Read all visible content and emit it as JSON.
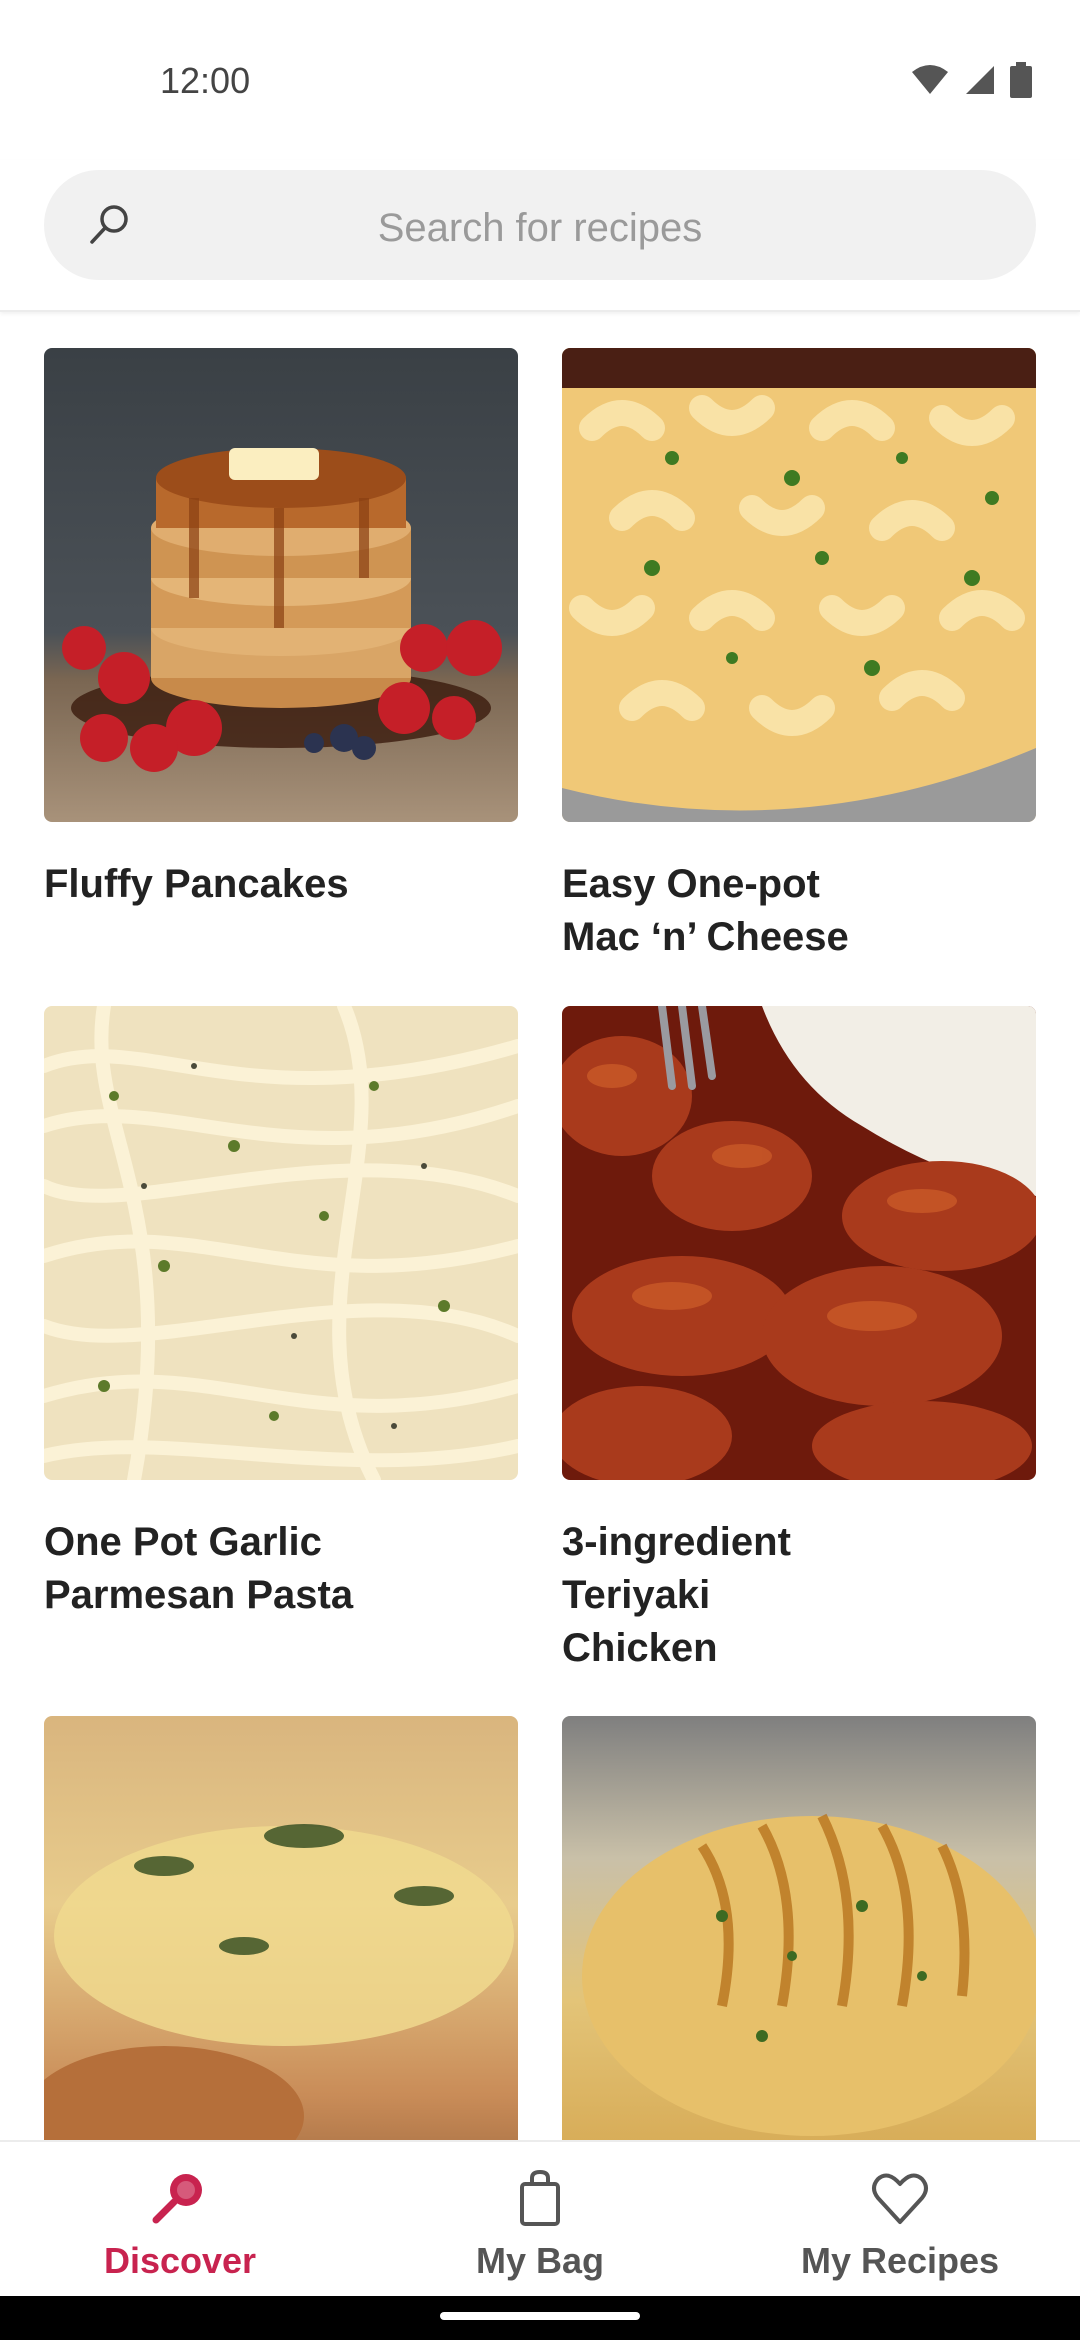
{
  "status_bar": {
    "time": "12:00"
  },
  "search": {
    "placeholder": "Search for recipes"
  },
  "recipes": [
    {
      "title": "Fluffy Pancakes",
      "image": "pancakes-photo"
    },
    {
      "title": "Easy One-pot Mac ‘n’ Cheese",
      "image": "mac-and-cheese-photo"
    },
    {
      "title": "One Pot Garlic Parmesan Pasta",
      "image": "garlic-parmesan-pasta-photo"
    },
    {
      "title": "3-ingredient Teriyaki Chicken",
      "image": "teriyaki-chicken-photo"
    },
    {
      "title": "",
      "image": "creamy-chicken-photo"
    },
    {
      "title": "",
      "image": "hasselback-chicken-photo"
    }
  ],
  "bottom_nav": {
    "items": [
      {
        "label": "Discover",
        "icon": "search-icon",
        "active": true
      },
      {
        "label": "My Bag",
        "icon": "shopping-bag-icon",
        "active": false
      },
      {
        "label": "My Recipes",
        "icon": "heart-icon",
        "active": false
      }
    ],
    "active_color": "#c8234f",
    "inactive_color": "#555555"
  }
}
